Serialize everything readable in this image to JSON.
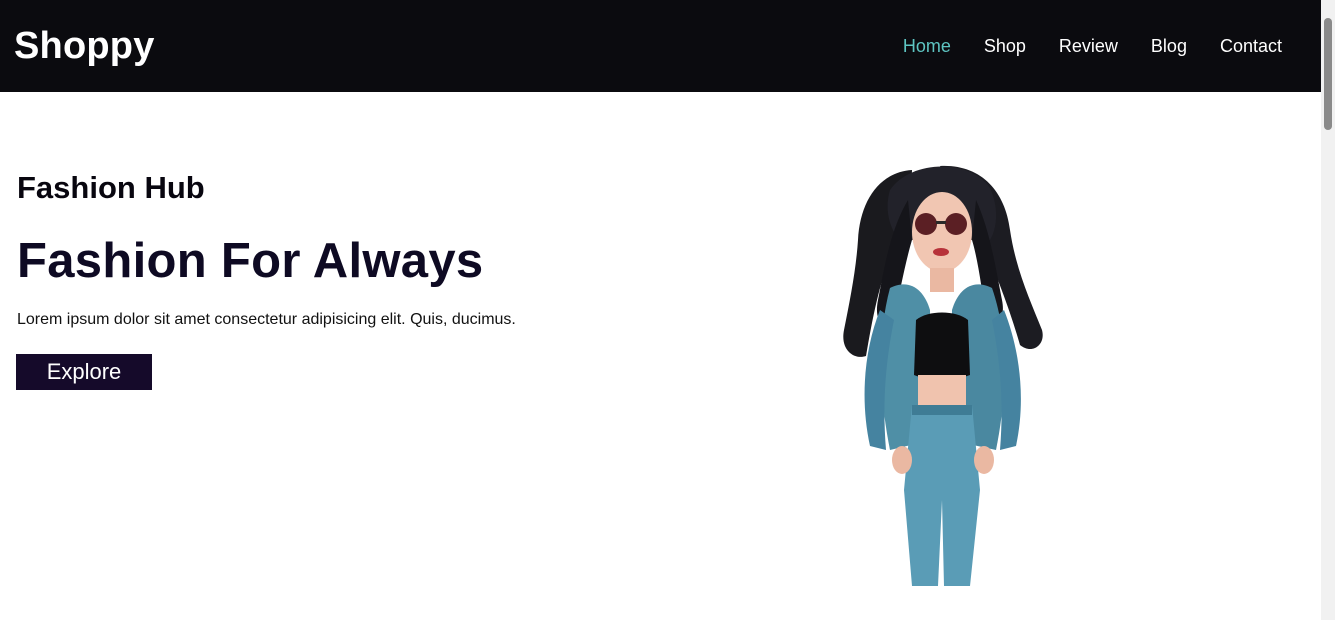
{
  "header": {
    "logo": "Shoppy",
    "nav": [
      {
        "label": "Home",
        "active": true
      },
      {
        "label": "Shop",
        "active": false
      },
      {
        "label": "Review",
        "active": false
      },
      {
        "label": "Blog",
        "active": false
      },
      {
        "label": "Contact",
        "active": false
      }
    ]
  },
  "hero": {
    "subtitle": "Fashion Hub",
    "title": "Fashion For Always",
    "description": "Lorem ipsum dolor sit amet consectetur adipisicing elit. Quis, ducimus.",
    "button_label": "Explore",
    "image_alt": "fashion-model-illustration"
  },
  "colors": {
    "nav_bg": "#0b0b0f",
    "active_link": "#5ec5c2",
    "button_bg": "#150a2a",
    "title": "#0e0a23"
  }
}
